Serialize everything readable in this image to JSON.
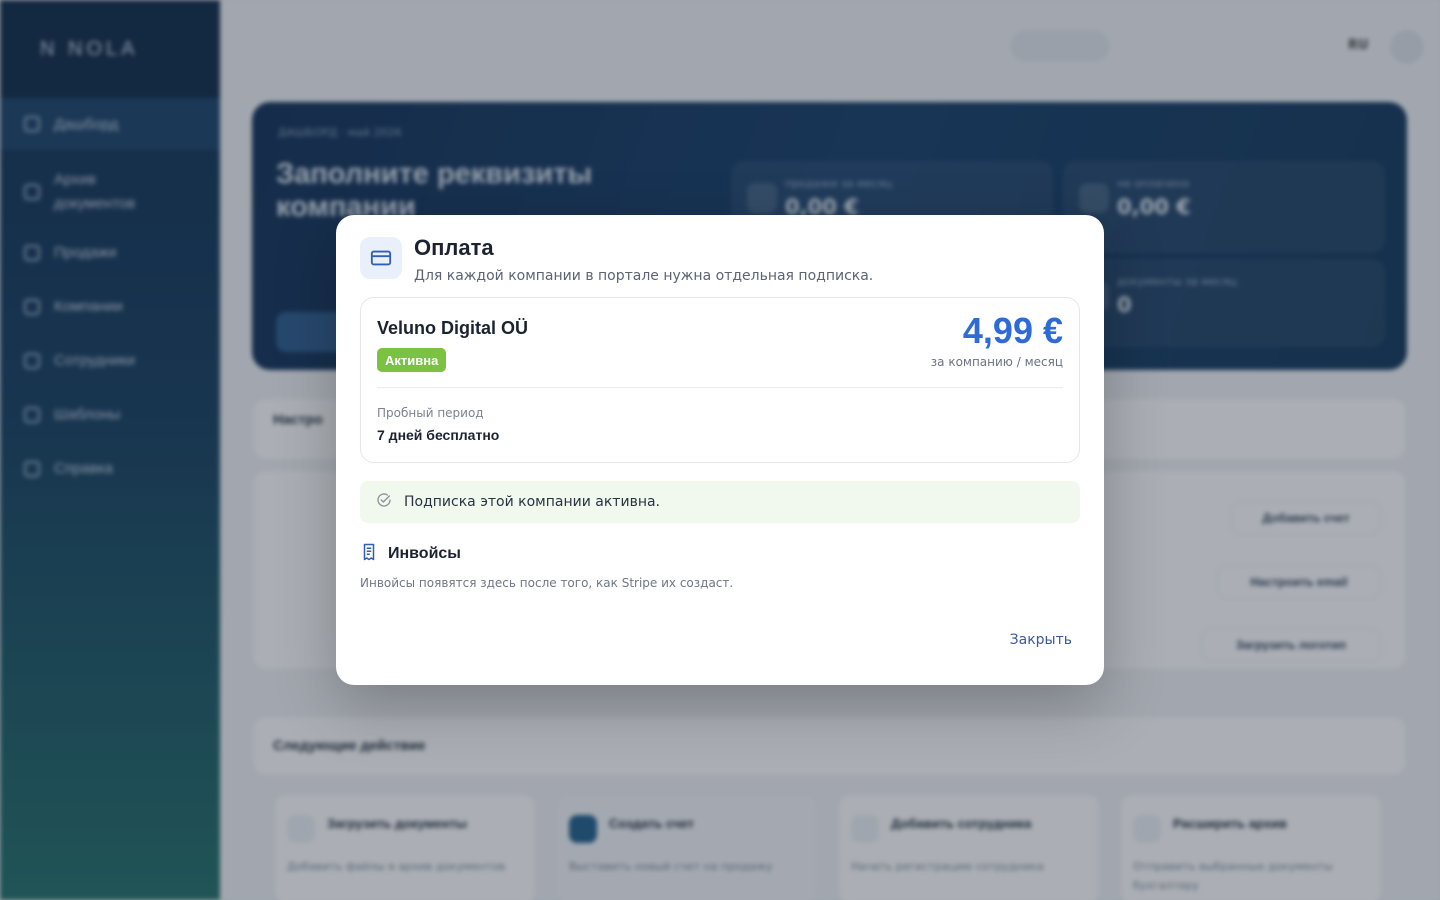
{
  "background": {
    "logo": "N  NOLA",
    "sidebar": {
      "items": [
        {
          "label": "Дашборд"
        },
        {
          "label": "Архив документов"
        },
        {
          "label": "Продажи"
        },
        {
          "label": "Компании"
        },
        {
          "label": "Сотрудники"
        },
        {
          "label": "Шаблоны"
        },
        {
          "label": "Справка"
        }
      ]
    },
    "topbar": {
      "lang": "RU"
    },
    "hero": {
      "breadcrumb": "ДАШБОРД · май 2026",
      "title": "Заполните реквизиты компании",
      "stats": [
        {
          "label": "продажи за месяц",
          "value": "0,00 €"
        },
        {
          "label": "не оплачено",
          "value": "0,00 €"
        },
        {
          "label": "документы за месяц",
          "value": "0"
        }
      ]
    },
    "setup": {
      "title": "Настро",
      "actions": [
        "Добавить счет",
        "Настроить email",
        "Загрузить логотип"
      ]
    },
    "next": {
      "title": "Следующие действие",
      "cards": [
        {
          "title": "Загрузить документы",
          "desc": "Добавить файлы в архив документов"
        },
        {
          "title": "Создать счет",
          "desc": "Выставить новый счет на продажу"
        },
        {
          "title": "Добавить сотрудника",
          "desc": "Начать регистрацию сотрудника"
        },
        {
          "title": "Расширить архив",
          "desc": "Отправить выбранные документы бухгалтеру"
        }
      ]
    }
  },
  "modal": {
    "title": "Оплата",
    "subtitle": "Для каждой компании в портале нужна отдельная подписка.",
    "plan": {
      "company": "Veluno Digital OÜ",
      "badge": "Активна",
      "price": "4,99 €",
      "period": "за компанию / месяц",
      "trial_label": "Пробный период",
      "trial_value": "7 дней бесплатно"
    },
    "status": "Подписка этой компании активна.",
    "invoices": {
      "title": "Инвойсы",
      "note": "Инвойсы появятся здесь после того, как Stripe их создаст."
    },
    "close_label": "Закрыть"
  },
  "colors": {
    "accent": "#2f6bd8",
    "badge": "#7bc142",
    "status_bg": "#f1f8ee"
  },
  "icons": [
    "credit-card-icon",
    "check-circle-icon",
    "receipt-icon"
  ]
}
